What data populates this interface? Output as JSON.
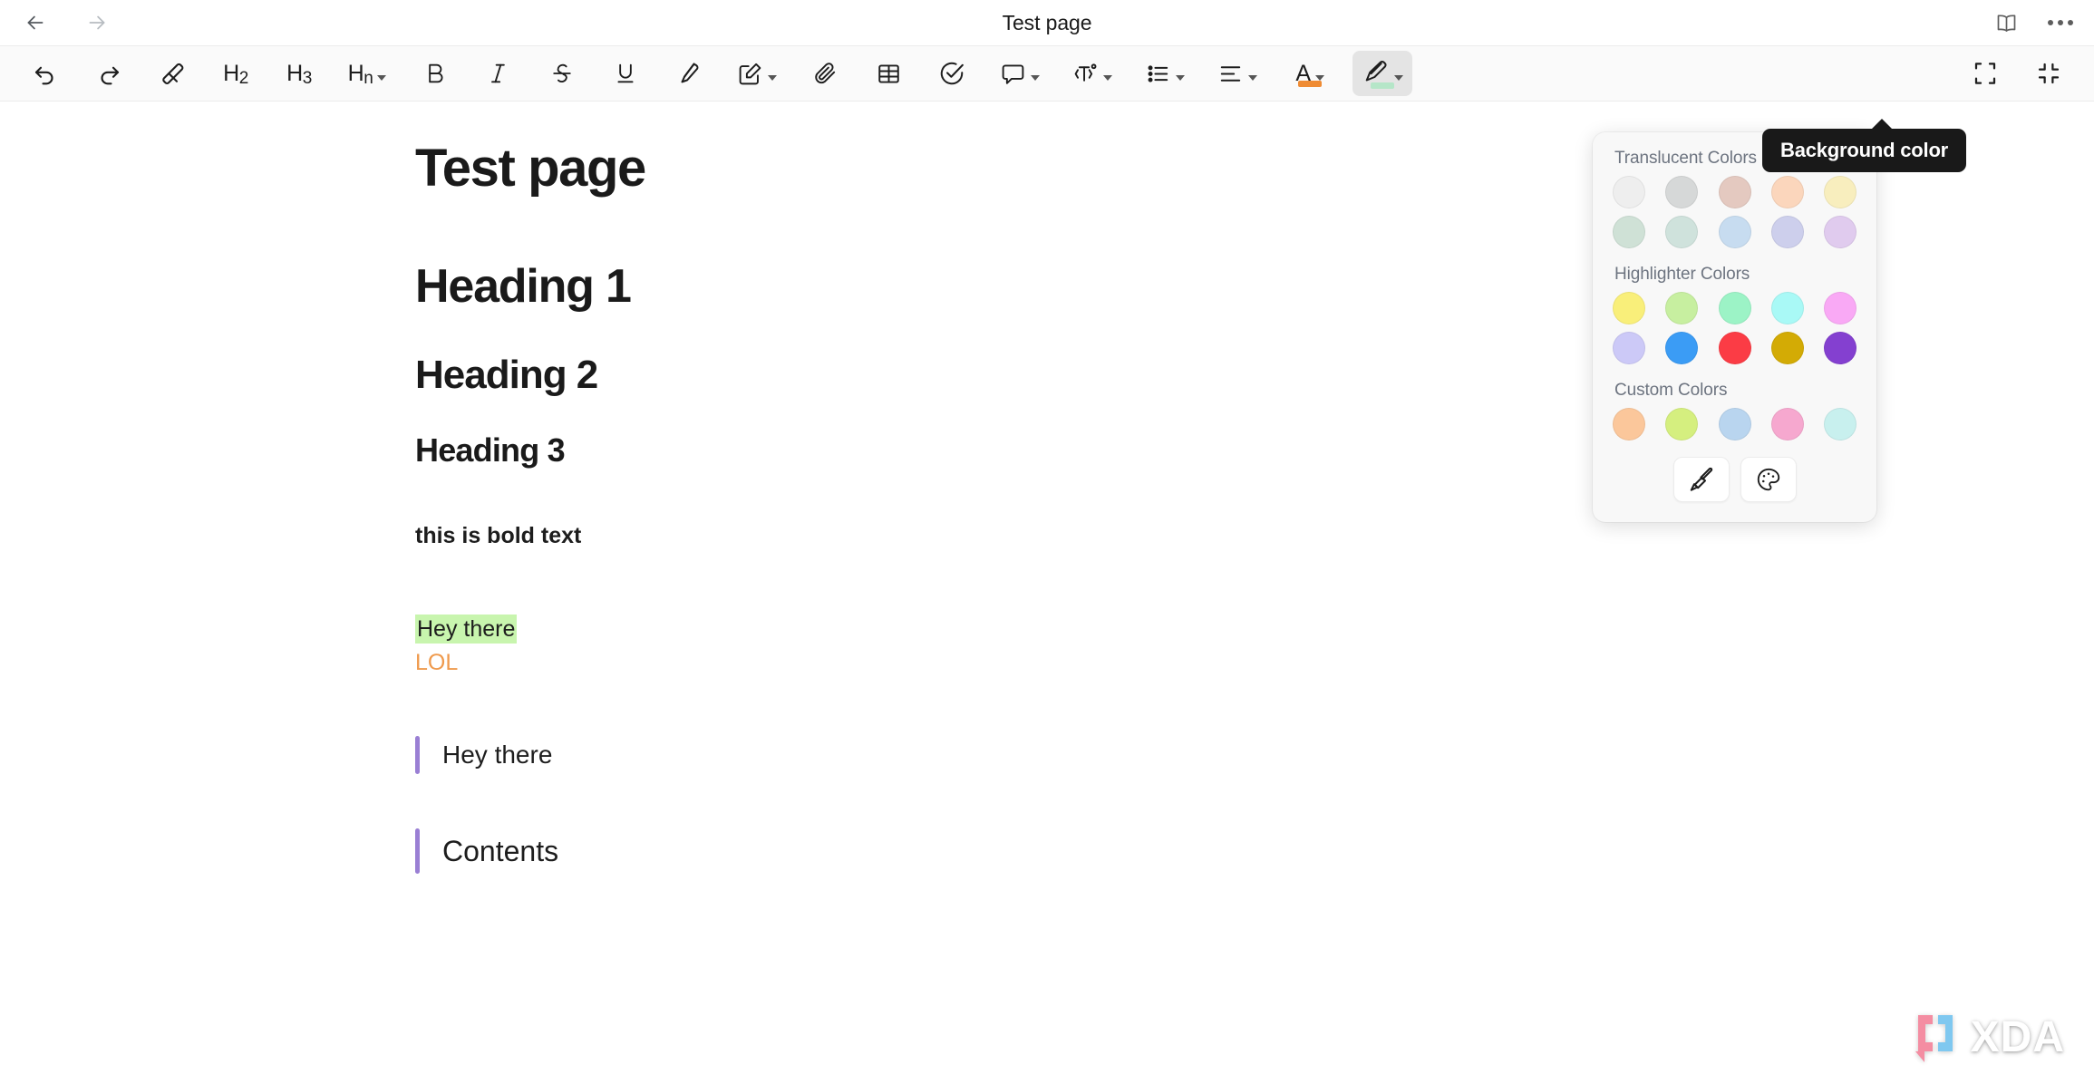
{
  "titlebar": {
    "back_label": "Back",
    "forward_label": "Forward",
    "title": "Test page",
    "reading_mode_label": "Reading mode",
    "more_label": "More options"
  },
  "toolbar": {
    "items": [
      {
        "name": "undo",
        "icon": "undo-icon",
        "label": "",
        "caret": false
      },
      {
        "name": "redo",
        "icon": "redo-icon",
        "label": "",
        "caret": false
      },
      {
        "name": "clear-format",
        "icon": "eraser-icon",
        "label": "",
        "caret": false
      },
      {
        "name": "heading-2",
        "icon": "h2-text",
        "label": "H2",
        "caret": false
      },
      {
        "name": "heading-3",
        "icon": "h3-text",
        "label": "H3",
        "caret": false
      },
      {
        "name": "heading-n",
        "icon": "hn-text",
        "label": "Hn",
        "caret": true
      },
      {
        "name": "bold",
        "icon": "bold-icon",
        "label": "B",
        "caret": false
      },
      {
        "name": "italic",
        "icon": "italic-icon",
        "label": "I",
        "caret": false
      },
      {
        "name": "strikethrough",
        "icon": "strikethrough-icon",
        "label": "S",
        "caret": false
      },
      {
        "name": "underline",
        "icon": "underline-icon",
        "label": "U",
        "caret": false
      },
      {
        "name": "highlighter",
        "icon": "highlighter-icon",
        "label": "",
        "caret": false
      },
      {
        "name": "annotate",
        "icon": "pen-edit-icon",
        "label": "",
        "caret": true
      },
      {
        "name": "attachment",
        "icon": "paperclip-icon",
        "label": "",
        "caret": false
      },
      {
        "name": "table",
        "icon": "table-icon",
        "label": "",
        "caret": false
      },
      {
        "name": "todo",
        "icon": "check-circle-icon",
        "label": "",
        "caret": false
      },
      {
        "name": "comment",
        "icon": "comment-icon",
        "label": "",
        "caret": true
      },
      {
        "name": "text-format",
        "icon": "text-tool-icon",
        "label": "",
        "caret": true
      },
      {
        "name": "bullet-list",
        "icon": "bullet-list-icon",
        "label": "",
        "caret": true
      },
      {
        "name": "align",
        "icon": "align-icon",
        "label": "",
        "caret": true
      },
      {
        "name": "font-color",
        "icon": "font-color-icon",
        "label": "A",
        "caret": true
      },
      {
        "name": "background-color",
        "icon": "background-color-icon",
        "label": "",
        "caret": true
      },
      {
        "name": "expand",
        "icon": "expand-icon",
        "label": "",
        "caret": false
      },
      {
        "name": "collapse",
        "icon": "collapse-icon",
        "label": "",
        "caret": false
      }
    ],
    "font_color_swatch": "#ef8b33",
    "background_color_swatch": "#b5e6c8"
  },
  "tooltip": {
    "text": "Background color"
  },
  "color_panel": {
    "translucent_label": "Translucent Colors",
    "translucent_row1": [
      "#eeeeee",
      "#d6d8d8",
      "#e4c9c0",
      "#fbd6bc",
      "#f8eebe"
    ],
    "translucent_row2": [
      "#cfe1d6",
      "#cfe2dc",
      "#c7dcf0",
      "#cdcfec",
      "#e0cbee"
    ],
    "highlighter_label": "Highlighter Colors",
    "highlighter_row1": [
      "#f9ef7a",
      "#c7efa0",
      "#9cf3c6",
      "#a9f9f6",
      "#f9a9f5"
    ],
    "highlighter_row2": [
      "#ccc9f7",
      "#3b9cf5",
      "#fb3c45",
      "#d3ab05",
      "#8440d0"
    ],
    "custom_label": "Custom Colors",
    "custom_row": [
      "#fbc79b",
      "#d5ef7f",
      "#b9d5ef",
      "#f6a8cf",
      "#c8f0ee"
    ],
    "brush_button_label": "Clear background",
    "palette_button_label": "Custom color"
  },
  "document": {
    "title": "Test page",
    "heading1": "Heading 1",
    "heading2": "Heading 2",
    "heading3": "Heading 3",
    "bold_text": "this is bold text",
    "highlight_text": "Hey there",
    "highlight_color": "#c8f5ae",
    "colored_text": "LOL",
    "colored_text_color": "#ef9a4d",
    "quote1": "Hey there",
    "quote2": "Contents",
    "quote_bar_color": "#9a7fd4"
  },
  "watermark": {
    "text": "XDA"
  }
}
